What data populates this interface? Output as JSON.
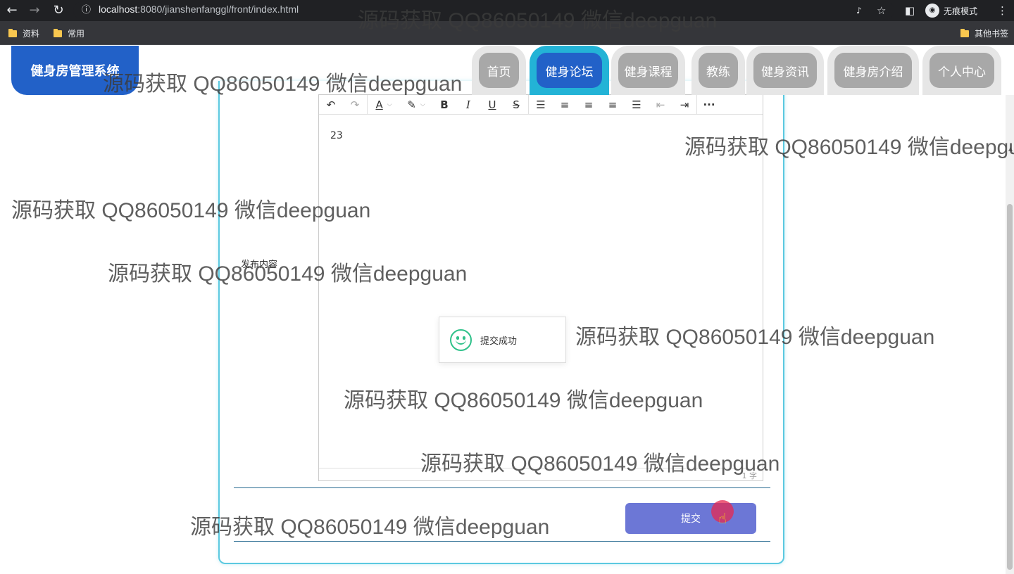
{
  "browser": {
    "url_host": "localhost",
    "url_path": ":8080/jianshenfanggl/front/index.html",
    "incognito_label": "无痕模式",
    "bookmarks": [
      "资料",
      "常用"
    ],
    "other_bookmarks": "其他书签"
  },
  "site": {
    "brand": "健身房管理系统",
    "nav": [
      {
        "label": "首页",
        "active": false
      },
      {
        "label": "健身论坛",
        "active": true
      },
      {
        "label": "健身课程",
        "active": false
      },
      {
        "label": "教练",
        "active": false
      },
      {
        "label": "健身资讯",
        "active": false
      },
      {
        "label": "健身房介绍",
        "active": false
      },
      {
        "label": "个人中心",
        "active": false
      }
    ]
  },
  "form": {
    "content_label": "发布内容",
    "editor_text": "23",
    "word_count": "1 字",
    "submit_label": "提交"
  },
  "toast": {
    "message": "提交成功"
  },
  "watermark": "源码获取 QQ86050149 微信deepguan",
  "colors": {
    "brand": "#2261c8",
    "active_tab_outer": "#23b3d6",
    "submit": "#6c77d6",
    "card_border": "#5bc9e0"
  },
  "icons": [
    "back-icon",
    "forward-icon",
    "reload-icon",
    "info-icon",
    "star-icon",
    "undo-icon",
    "redo-icon",
    "font-color-icon",
    "highlight-icon",
    "bold-icon",
    "italic-icon",
    "underline-icon",
    "strikethrough-icon",
    "list-icon",
    "align-left-icon",
    "align-center-icon",
    "align-right-icon",
    "justify-icon",
    "outdent-icon",
    "indent-icon",
    "more-icon",
    "smile-icon"
  ]
}
